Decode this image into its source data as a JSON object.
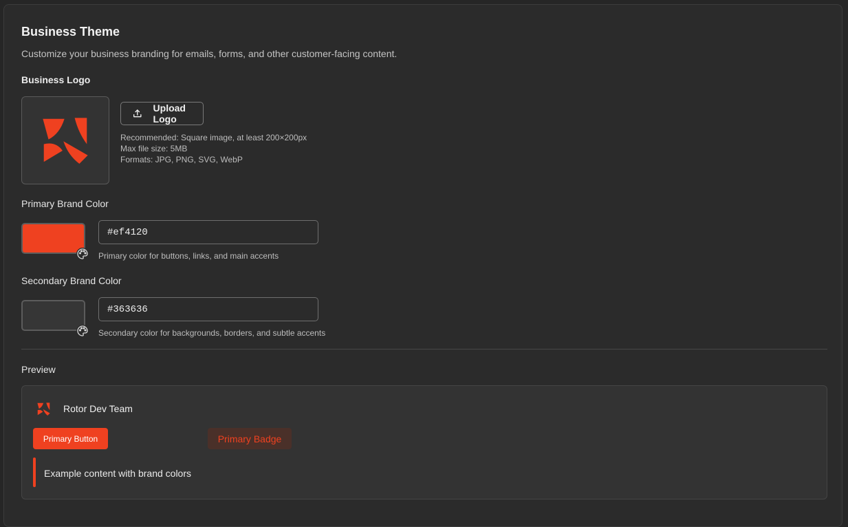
{
  "section": {
    "title": "Business Theme",
    "subtitle": "Customize your business branding for emails, forms, and other customer-facing content."
  },
  "logo": {
    "label": "Business Logo",
    "upload_label": "Upload Logo",
    "icon": "upload-icon",
    "hints": [
      "Recommended: Square image, at least 200×200px",
      "Max file size: 5MB",
      "Formats: JPG, PNG, SVG, WebP"
    ]
  },
  "primary_color": {
    "label": "Primary Brand Color",
    "value": "#ef4120",
    "description": "Primary color for buttons, links, and main accents",
    "icon": "palette-icon"
  },
  "secondary_color": {
    "label": "Secondary Brand Color",
    "value": "#363636",
    "description": "Secondary color for backgrounds, borders, and subtle accents",
    "icon": "palette-icon"
  },
  "preview": {
    "label": "Preview",
    "team_name": "Rotor Dev Team",
    "primary_button": "Primary Button",
    "primary_badge": "Primary Badge",
    "example_text": "Example content with brand colors"
  },
  "colors": {
    "primary": "#ef4120",
    "secondary": "#363636",
    "background": "#2b2b2b"
  }
}
